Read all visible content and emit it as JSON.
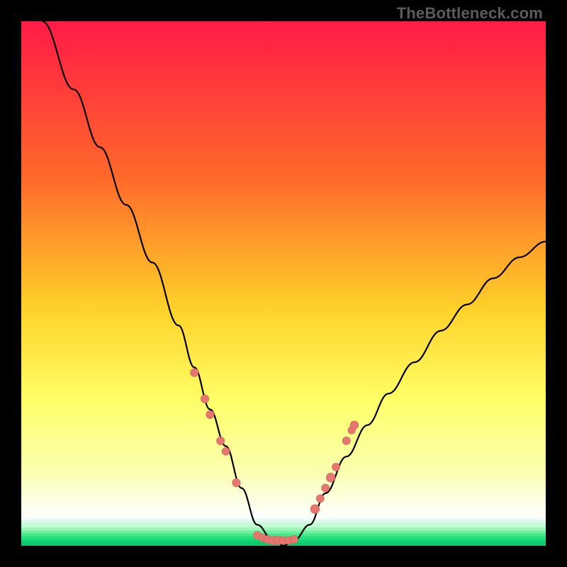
{
  "watermark": "TheBottleneck.com",
  "colors": {
    "frame": "#000000",
    "gradient_top": "#ff1a47",
    "gradient_mid1": "#ff6a2a",
    "gradient_mid2": "#ffd22a",
    "gradient_mid3": "#ffff66",
    "gradient_low": "#faffb0",
    "gradient_bottom": "#12e07a",
    "curve": "#000000",
    "marker_fill": "#e4776f",
    "marker_stroke": "#d65c55"
  },
  "chart_data": {
    "type": "line",
    "title": "",
    "xlabel": "",
    "ylabel": "",
    "xlim": [
      0,
      100
    ],
    "ylim": [
      0,
      100
    ],
    "note": "Bottleneck curve: y represents bottleneck percentage (color gradient from green=0 to red=100). Minimum (~0) occurs near x≈45–52. Curve rises steeply toward x=0 (y≈100) and toward x=100 (y≈58).",
    "series": [
      {
        "name": "bottleneck-curve",
        "x": [
          4,
          10,
          15,
          20,
          25,
          30,
          33,
          36,
          39,
          42,
          45,
          48,
          50,
          52,
          55,
          58,
          62,
          66,
          70,
          75,
          80,
          85,
          90,
          95,
          100
        ],
        "y": [
          100,
          87,
          76,
          65,
          54,
          42,
          34,
          26,
          19,
          11,
          4,
          1,
          0,
          1,
          4,
          10,
          17,
          23,
          29,
          35,
          41,
          46,
          51,
          55,
          58
        ]
      }
    ],
    "markers": {
      "name": "highlight-points",
      "note": "Salmon dots clustered along the lower V of the curve",
      "x": [
        33,
        35,
        36,
        38,
        39,
        41,
        45,
        46,
        47,
        48,
        49,
        50,
        51,
        52,
        56,
        57,
        58,
        59,
        60,
        62,
        63,
        63.5
      ],
      "y": [
        33,
        28,
        25,
        20,
        18,
        12,
        2,
        1.5,
        1.2,
        1,
        1,
        1,
        1,
        1.2,
        7,
        9,
        11,
        13,
        15,
        20,
        22,
        23
      ]
    }
  }
}
